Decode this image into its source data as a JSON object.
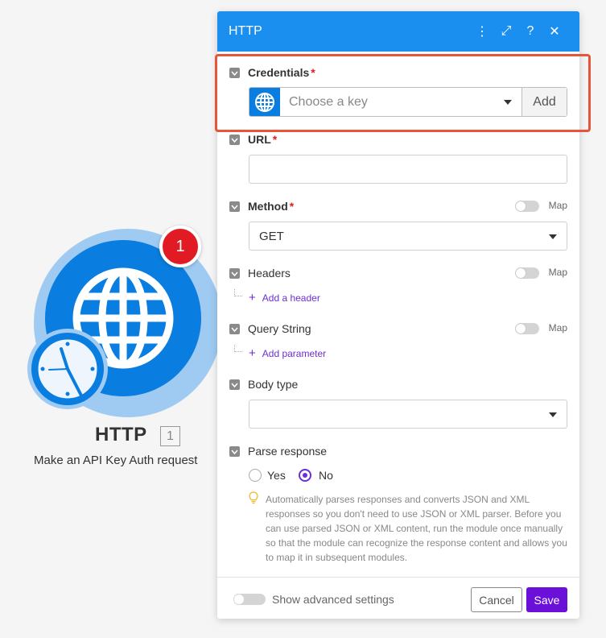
{
  "module": {
    "badge_count": "1",
    "title": "HTTP",
    "number": "1",
    "subtitle": "Make an API Key Auth request",
    "icon": "globe-icon",
    "secondary_icon": "clock-icon"
  },
  "panel": {
    "title": "HTTP",
    "header_icons": {
      "menu": "⋮",
      "expand": "⤢",
      "help": "?",
      "close": "✕"
    },
    "credentials": {
      "label": "Credentials",
      "required": "*",
      "placeholder": "Choose a key",
      "add_label": "Add"
    },
    "url": {
      "label": "URL",
      "required": "*",
      "value": ""
    },
    "method": {
      "label": "Method",
      "required": "*",
      "value": "GET",
      "map_label": "Map"
    },
    "headers": {
      "label": "Headers",
      "map_label": "Map",
      "add_label": "Add a header"
    },
    "query_string": {
      "label": "Query String",
      "map_label": "Map",
      "add_label": "Add parameter"
    },
    "body_type": {
      "label": "Body type",
      "value": ""
    },
    "parse_response": {
      "label": "Parse response",
      "options": [
        "Yes",
        "No"
      ],
      "selected": "No",
      "hint": "Automatically parses responses and converts JSON and XML responses so you don't need to use JSON or XML parser. Before you can use parsed JSON or XML content, run the module once manually so that the module can recognize the response content and allows you to map it in subsequent modules."
    },
    "footer": {
      "advanced_label": "Show advanced settings",
      "cancel_label": "Cancel",
      "save_label": "Save"
    }
  },
  "colors": {
    "header_blue": "#1a8ff0",
    "module_blue": "#0a7de0",
    "badge_red": "#e01b24",
    "accent_purple": "#6b10d8",
    "highlight_orange": "#e8553b"
  }
}
